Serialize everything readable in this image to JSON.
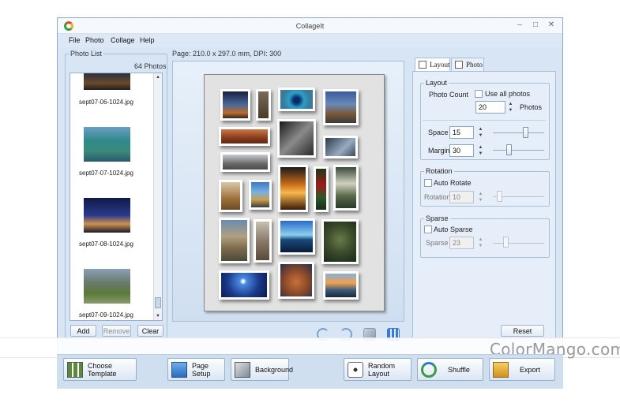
{
  "window": {
    "title": "CollageIt",
    "minimize": "–",
    "maximize": "□",
    "close": "✕"
  },
  "menu": [
    "File",
    "Photo",
    "Collage",
    "Help"
  ],
  "photo_list": {
    "title": "Photo List",
    "count": "64 Photos",
    "items": [
      {
        "name": "sept07-06-1024.jpg"
      },
      {
        "name": "sept07-07-1024.jpg"
      },
      {
        "name": "sept07-08-1024.jpg"
      },
      {
        "name": "sept07-09-1024.jpg"
      }
    ],
    "add_label": "Add",
    "remove_label": "Remove",
    "clear_label": "Clear"
  },
  "page_info": "Page: 210.0 x 297.0 mm, DPI: 300",
  "tabs": [
    {
      "label": "Layout"
    },
    {
      "label": "Photo"
    }
  ],
  "layout": {
    "group_title": "Layout",
    "photo_count_label": "Photo Count",
    "use_all_label": "Use all photos",
    "use_all_checked": false,
    "count_value": "20",
    "photos_unit": "Photos",
    "space_label": "Space",
    "space_value": "15",
    "margin_label": "Margin",
    "margin_value": "30"
  },
  "rotation": {
    "group_title": "Rotation",
    "auto_label": "Auto Rotate",
    "auto_checked": false,
    "value_label": "Rotation",
    "value": "10"
  },
  "sparse": {
    "group_title": "Sparse",
    "auto_label": "Auto Sparse",
    "auto_checked": false,
    "value_label": "Sparse",
    "value": "23"
  },
  "reset_label": "Reset",
  "bottom": {
    "choose_template": "Choose Template",
    "page_setup": "Page Setup",
    "background": "Background",
    "random_layout": "Random Layout",
    "shuffle": "Shuffle",
    "export": "Export"
  },
  "watermark": "ColorMango.com",
  "colors": {
    "window_bg": "#d7e5f4",
    "accent": "#2a6fc9"
  }
}
